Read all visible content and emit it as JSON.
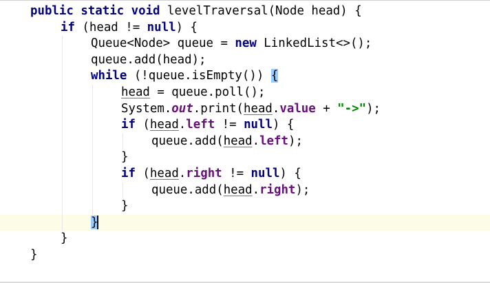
{
  "editor": {
    "lines": [
      {
        "indent": 0,
        "tokens": [
          {
            "t": "public",
            "c": "kw"
          },
          {
            "t": " "
          },
          {
            "t": "static",
            "c": "kw"
          },
          {
            "t": " "
          },
          {
            "t": "void",
            "c": "kw"
          },
          {
            "t": " levelTraversal(Node head) {"
          }
        ]
      },
      {
        "indent": 1,
        "tokens": [
          {
            "t": "if",
            "c": "kw"
          },
          {
            "t": " (head != "
          },
          {
            "t": "null",
            "c": "kw"
          },
          {
            "t": ") {"
          }
        ]
      },
      {
        "indent": 2,
        "tokens": [
          {
            "t": "Queue<Node> queue = "
          },
          {
            "t": "new",
            "c": "kw"
          },
          {
            "t": " LinkedList<>();"
          }
        ]
      },
      {
        "indent": 2,
        "tokens": [
          {
            "t": "queue.add(head);"
          }
        ]
      },
      {
        "indent": 2,
        "tokens": [
          {
            "t": "while",
            "c": "kw"
          },
          {
            "t": " (!queue.isEmpty()) "
          },
          {
            "t": "{",
            "c": "brace-hl"
          }
        ]
      },
      {
        "indent": 3,
        "tokens": [
          {
            "t": "head",
            "c": "ul"
          },
          {
            "t": " = queue.poll();"
          }
        ]
      },
      {
        "indent": 3,
        "tokens": [
          {
            "t": "System."
          },
          {
            "t": "out",
            "c": "st"
          },
          {
            "t": ".print("
          },
          {
            "t": "head",
            "c": "ul"
          },
          {
            "t": "."
          },
          {
            "t": "value",
            "c": "fld"
          },
          {
            "t": " + "
          },
          {
            "t": "\"->\"",
            "c": "str"
          },
          {
            "t": ");"
          }
        ]
      },
      {
        "indent": 3,
        "tokens": [
          {
            "t": "if",
            "c": "kw"
          },
          {
            "t": " ("
          },
          {
            "t": "head",
            "c": "ul"
          },
          {
            "t": "."
          },
          {
            "t": "left",
            "c": "fld"
          },
          {
            "t": " != "
          },
          {
            "t": "null",
            "c": "kw"
          },
          {
            "t": ") {"
          }
        ]
      },
      {
        "indent": 4,
        "tokens": [
          {
            "t": "queue.add("
          },
          {
            "t": "head",
            "c": "ul"
          },
          {
            "t": "."
          },
          {
            "t": "left",
            "c": "fld"
          },
          {
            "t": ");"
          }
        ]
      },
      {
        "indent": 3,
        "tokens": [
          {
            "t": "}"
          }
        ]
      },
      {
        "indent": 3,
        "tokens": [
          {
            "t": "if",
            "c": "kw"
          },
          {
            "t": " ("
          },
          {
            "t": "head",
            "c": "ul"
          },
          {
            "t": "."
          },
          {
            "t": "right",
            "c": "fld"
          },
          {
            "t": " != "
          },
          {
            "t": "null",
            "c": "kw"
          },
          {
            "t": ") {"
          }
        ]
      },
      {
        "indent": 4,
        "tokens": [
          {
            "t": "queue.add("
          },
          {
            "t": "head",
            "c": "ul"
          },
          {
            "t": "."
          },
          {
            "t": "right",
            "c": "fld"
          },
          {
            "t": ");"
          }
        ]
      },
      {
        "indent": 3,
        "tokens": [
          {
            "t": "}"
          }
        ]
      },
      {
        "indent": 2,
        "current": true,
        "caret": true,
        "tokens": [
          {
            "t": "}",
            "c": "brace-hl"
          }
        ]
      },
      {
        "indent": 1,
        "tokens": [
          {
            "t": "}"
          }
        ]
      },
      {
        "indent": 0,
        "tokens": [
          {
            "t": "}"
          }
        ]
      }
    ],
    "colors": {
      "keyword": "#000080",
      "field": "#660e7a",
      "string": "#008000",
      "brace_match": "#99ccff",
      "current_line": "#fdfce6"
    }
  }
}
